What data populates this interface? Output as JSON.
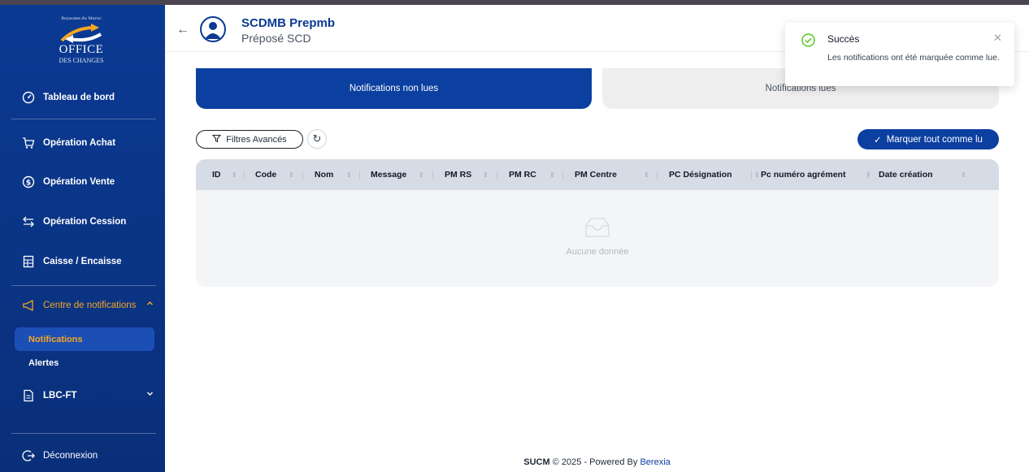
{
  "logo": {
    "crest_text": "Royaume du Maroc",
    "line1": "OFFICE",
    "line2": "DES CHANGES"
  },
  "sidebar": {
    "items": [
      {
        "label": "Tableau de bord",
        "icon": "dashboard-gauge-icon"
      },
      {
        "label": "Opération Achat",
        "icon": "cart-icon"
      },
      {
        "label": "Opération Vente",
        "icon": "dollar-circle-icon"
      },
      {
        "label": "Opération Cession",
        "icon": "swap-arrows-icon"
      },
      {
        "label": "Caisse / Encaisse",
        "icon": "cash-register-icon"
      },
      {
        "label": "Centre de notifications",
        "icon": "megaphone-icon",
        "expanded": true
      },
      {
        "label": "LBC-FT",
        "icon": "document-icon"
      }
    ],
    "sub_items": [
      {
        "label": "Notifications",
        "active": true
      },
      {
        "label": "Alertes",
        "active": false
      }
    ],
    "logout_label": "Déconnexion"
  },
  "header": {
    "user_name": "SCDMB Prepmb",
    "user_role": "Préposé SCD"
  },
  "tabs": [
    {
      "label": "Notifications non lues",
      "active": true
    },
    {
      "label": "Notifications lues",
      "active": false
    }
  ],
  "toolbar": {
    "filter_label": "Filtres Avancés",
    "mark_all_label": "Marquer tout comme lu"
  },
  "table": {
    "columns": [
      "ID",
      "Code",
      "Nom",
      "Message",
      "PM RS",
      "PM RC",
      "PM Centre",
      "PC Désignation",
      "Pc numéro agrément",
      "Date création"
    ],
    "empty_text": "Aucune donnée"
  },
  "footer": {
    "app": "SUCM",
    "text": " © 2025 - Powered By ",
    "brand": "Berexia"
  },
  "toast": {
    "title": "Succès",
    "message": "Les notifications ont été marquée comme lue."
  },
  "colors": {
    "primary": "#0b3fa0",
    "sidebar": "#0b3a93",
    "accent": "#f5a623",
    "success": "#52c41a"
  }
}
